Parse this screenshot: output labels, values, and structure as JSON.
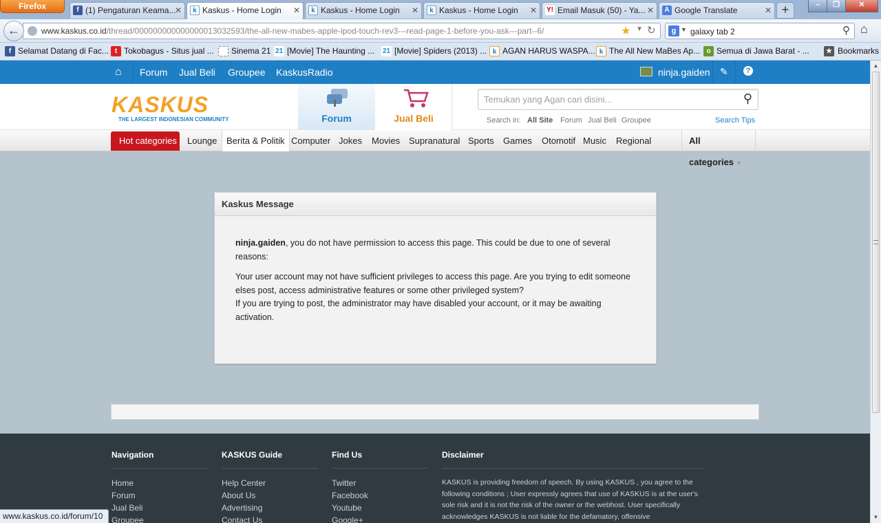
{
  "browser": {
    "menu_button": "Firefox",
    "tabs": [
      {
        "title": "(1) Pengaturan Keama...",
        "icon": "facebook-icon"
      },
      {
        "title": "Kaskus - Home Login",
        "icon": "kaskus-icon"
      },
      {
        "title": "Kaskus - Home Login",
        "icon": "kaskus-icon"
      },
      {
        "title": "Kaskus - Home Login",
        "icon": "kaskus-icon"
      },
      {
        "title": "Email Masuk (50) - Ya...",
        "icon": "yahoo-icon"
      },
      {
        "title": "Google Translate",
        "icon": "google-translate-icon"
      }
    ],
    "new_tab": "+",
    "url_domain": "www.kaskus.co.id",
    "url_path": "/thread/000000000000000013032593/the-all-new-mabes-apple-ipod-touch-rev3---read-page-1-before-you-ask---part--6/",
    "search_engine": "g",
    "search_value": "galaxy tab 2",
    "bookmarks": [
      {
        "label": "Selamat Datang di Fac...",
        "icon": "facebook-icon"
      },
      {
        "label": "Tokobagus - Situs jual ...",
        "icon": "tokobagus-icon"
      },
      {
        "label": "Sinema 21",
        "icon": "blank-page-icon"
      },
      {
        "label": "[Movie] The Haunting ...",
        "icon": "21-icon"
      },
      {
        "label": "[Movie] Spiders (2013) ...",
        "icon": "21-icon"
      },
      {
        "label": "AGAN HARUS WASPA...",
        "icon": "kaskus-icon"
      },
      {
        "label": "The All New MaBes Ap...",
        "icon": "kaskus-icon"
      },
      {
        "label": "Semua di Jawa Barat - ...",
        "icon": "olx-icon"
      }
    ],
    "bookmarks_menu": "Bookmarks",
    "status_url": "www.kaskus.co.id/forum/10"
  },
  "site": {
    "topnav": {
      "links": [
        "Forum",
        "Jual Beli",
        "Groupee",
        "KaskusRadio"
      ],
      "username": "ninja.gaiden"
    },
    "logo": {
      "text_a": "KAS",
      "text_b": "K",
      "text_c": "US",
      "tagline": "THE LARGEST INDONESIAN COMMUNITY"
    },
    "section_tabs": {
      "forum": "Forum",
      "jualbeli": "Jual Beli"
    },
    "search": {
      "placeholder": "Temukan yang Agan cari disini...",
      "search_in_label": "Search in:",
      "options": [
        "All Site",
        "Forum",
        "Jual Beli",
        "Groupee"
      ],
      "tips": "Search Tips"
    },
    "categories": {
      "hot": "Hot categories",
      "items": [
        "Lounge",
        "Berita & Politik",
        "Computer",
        "Jokes",
        "Movies",
        "Supranatural",
        "Sports",
        "Games",
        "Otomotif",
        "Music",
        "Regional"
      ],
      "all": "All categories"
    },
    "message": {
      "title": "Kaskus Message",
      "user": "ninja.gaiden",
      "line1": ", you do not have permission to access this page. This could be due to one of several reasons:",
      "line2": "Your user account may not have sufficient privileges to access this page. Are you trying to edit someone elses post, access administrative features or some other privileged system?",
      "line3": "If you are trying to post, the administrator may have disabled your account, or it may be awaiting activation."
    },
    "footer": {
      "navigation": {
        "title": "Navigation",
        "links": [
          "Home",
          "Forum",
          "Jual Beli",
          "Groupee"
        ]
      },
      "guide": {
        "title": "KASKUS Guide",
        "links": [
          "Help Center",
          "About Us",
          "Advertising",
          "Contact Us"
        ]
      },
      "findus": {
        "title": "Find Us",
        "links": [
          "Twitter",
          "Facebook",
          "Youtube",
          "Google+"
        ]
      },
      "disclaimer": {
        "title": "Disclaimer",
        "text": "KASKUS is providing freedom of speech. By using KASKUS , you agree to the following conditions ; User expressly agrees that use of KASKUS is at the user's sole risk and it is not the risk of the owner or the webhost. User specifically acknowledges KASKUS is not liable for the defamatory, offensive"
      }
    }
  },
  "colors": {
    "kaskus_blue": "#1f7fc5",
    "kaskus_orange": "#f3a12a",
    "hot_red": "#c8171e",
    "footer_bg": "#2f3b40"
  }
}
